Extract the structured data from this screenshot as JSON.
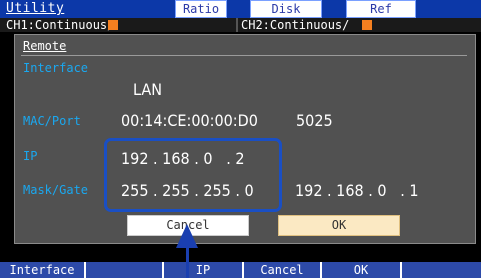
{
  "header": {
    "title": "Utility",
    "modes": [
      "Ratio",
      "Disk",
      "Ref"
    ]
  },
  "channels": {
    "ch1": "CH1:Continuous/",
    "ch2": "CH2:Continuous/"
  },
  "dialog": {
    "title": "Remote",
    "labels": {
      "interface": "Interface",
      "mac_port": "MAC/Port",
      "ip": "IP",
      "mask_gate": "Mask/Gate"
    },
    "values": {
      "interface": "LAN",
      "mac": "00:14:CE:00:00:D0",
      "port": "5025",
      "ip": "192 . 168 . 0   . 2",
      "mask": "255 . 255 . 255 . 0",
      "gateway": "192 . 168 . 0   . 1"
    },
    "buttons": {
      "cancel": "Cancel",
      "ok": "OK"
    }
  },
  "function_keys": [
    "Interface",
    "",
    "IP",
    "Cancel",
    "OK",
    ""
  ],
  "colors": {
    "title_bar": "#0c38a8",
    "label": "#1aa8f0",
    "channel_indicator": "#f58020",
    "callout": "#1a4fc4",
    "function_key": "#2d4aa8"
  }
}
